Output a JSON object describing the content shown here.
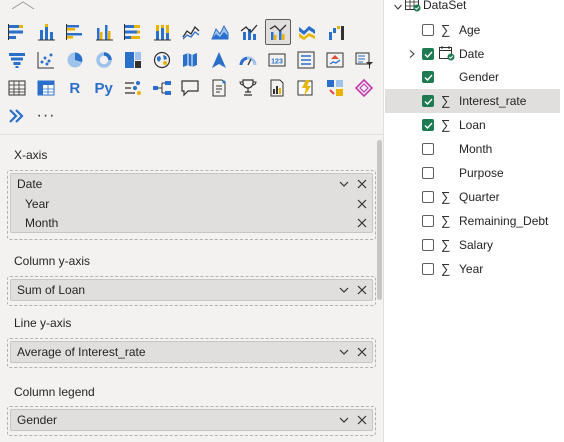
{
  "visualizations": {
    "rows": [
      [
        "stacked-bar-chart-icon",
        "stacked-column-chart-icon",
        "clustered-bar-chart-icon",
        "clustered-column-chart-icon",
        "100-stacked-bar-chart-icon",
        "100-stacked-column-chart-icon",
        "line-chart-icon",
        "area-chart-icon",
        "line-and-stacked-column-chart-icon",
        "line-and-clustered-column-chart-icon",
        "ribbon-chart-icon",
        "waterfall-chart-icon"
      ],
      [
        "funnel-chart-icon",
        "scatter-chart-icon",
        "pie-chart-icon",
        "donut-chart-icon",
        "treemap-icon",
        "map-icon",
        "filled-map-icon",
        "azure-map-icon",
        "gauge-icon",
        "card-icon",
        "multi-row-card-icon",
        "kpi-icon",
        "slicer-icon"
      ],
      [
        "table-icon",
        "matrix-icon",
        "r-script-visual-icon",
        "python-visual-icon",
        "key-influencers-icon",
        "decomposition-tree-icon",
        "qa-icon",
        "smart-narrative-icon",
        "metrics-icon",
        "paginated-report-icon",
        "power-apps-icon",
        "power-automate-icon",
        "get-more-visuals-icon"
      ],
      [
        "arcgis-icon",
        "more-options-icon"
      ]
    ],
    "selected": "line-and-clustered-column-chart-icon",
    "r_label": "R",
    "py_label": "Py",
    "more_label": "···"
  },
  "wells": {
    "x_axis": {
      "label": "X-axis",
      "field": "Date",
      "sub_fields": [
        "Year",
        "Month"
      ]
    },
    "column_y_axis": {
      "label": "Column y-axis",
      "field": "Sum of Loan"
    },
    "line_y_axis": {
      "label": "Line y-axis",
      "field": "Average of Interest_rate"
    },
    "column_legend": {
      "label": "Column legend",
      "field": "Gender"
    }
  },
  "data_pane": {
    "table_name": "DataSet",
    "fields": [
      {
        "name": "Age",
        "type": "sigma",
        "checked": false
      },
      {
        "name": "Date",
        "type": "calendar",
        "checked": true,
        "expandable": true
      },
      {
        "name": "Gender",
        "type": "text",
        "checked": true
      },
      {
        "name": "Interest_rate",
        "type": "sigma",
        "checked": true,
        "selected": true
      },
      {
        "name": "Loan",
        "type": "sigma",
        "checked": true
      },
      {
        "name": "Month",
        "type": "text",
        "checked": false
      },
      {
        "name": "Purpose",
        "type": "text",
        "checked": false
      },
      {
        "name": "Quarter",
        "type": "sigma",
        "checked": false
      },
      {
        "name": "Remaining_Debt",
        "type": "sigma",
        "checked": false
      },
      {
        "name": "Salary",
        "type": "sigma",
        "checked": false
      },
      {
        "name": "Year",
        "type": "sigma",
        "checked": false
      }
    ]
  },
  "colors": {
    "accent_green": "#1e7a50",
    "pane_bg": "#f3f2f1",
    "pill_bg": "#e1dfdd",
    "icon_blue": "#2a6fc9",
    "icon_yellow": "#e8b400"
  }
}
